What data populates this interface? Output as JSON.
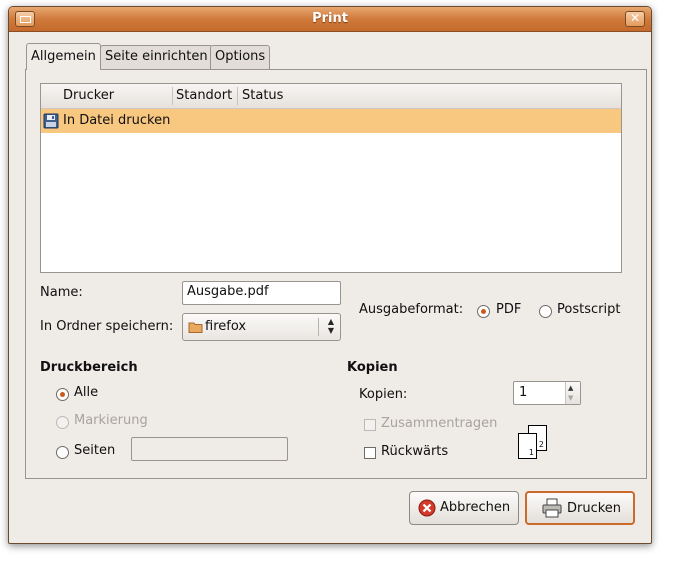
{
  "window": {
    "title": "Print"
  },
  "tabs": [
    {
      "label": "Allgemein"
    },
    {
      "label": "Seite einrichten"
    },
    {
      "label": "Options"
    }
  ],
  "printer_list": {
    "columns": [
      "Drucker",
      "Standort",
      "Status"
    ],
    "rows": [
      {
        "name": "In Datei drucken"
      }
    ]
  },
  "file": {
    "name_label": "Name:",
    "name_value": "Ausgabe.pdf",
    "folder_label": "In Ordner speichern:",
    "folder_value": "firefox",
    "format_label": "Ausgabeformat:",
    "format_options": [
      "PDF",
      "Postscript"
    ],
    "format_selected": "PDF"
  },
  "range": {
    "heading": "Druckbereich",
    "all": "Alle",
    "selection": "Markierung",
    "pages": "Seiten",
    "pages_value": ""
  },
  "copies": {
    "heading": "Kopien",
    "copies_label": "Kopien:",
    "copies_value": "1",
    "collate": "Zusammentragen",
    "reverse": "Rückwärts",
    "page_icons": [
      "1",
      "2"
    ]
  },
  "buttons": {
    "cancel": "Abbrechen",
    "print": "Drucken"
  },
  "colors": {
    "accent": "#cc6a2c",
    "selection": "#f8c780",
    "titlebar": "#d07a3c"
  }
}
